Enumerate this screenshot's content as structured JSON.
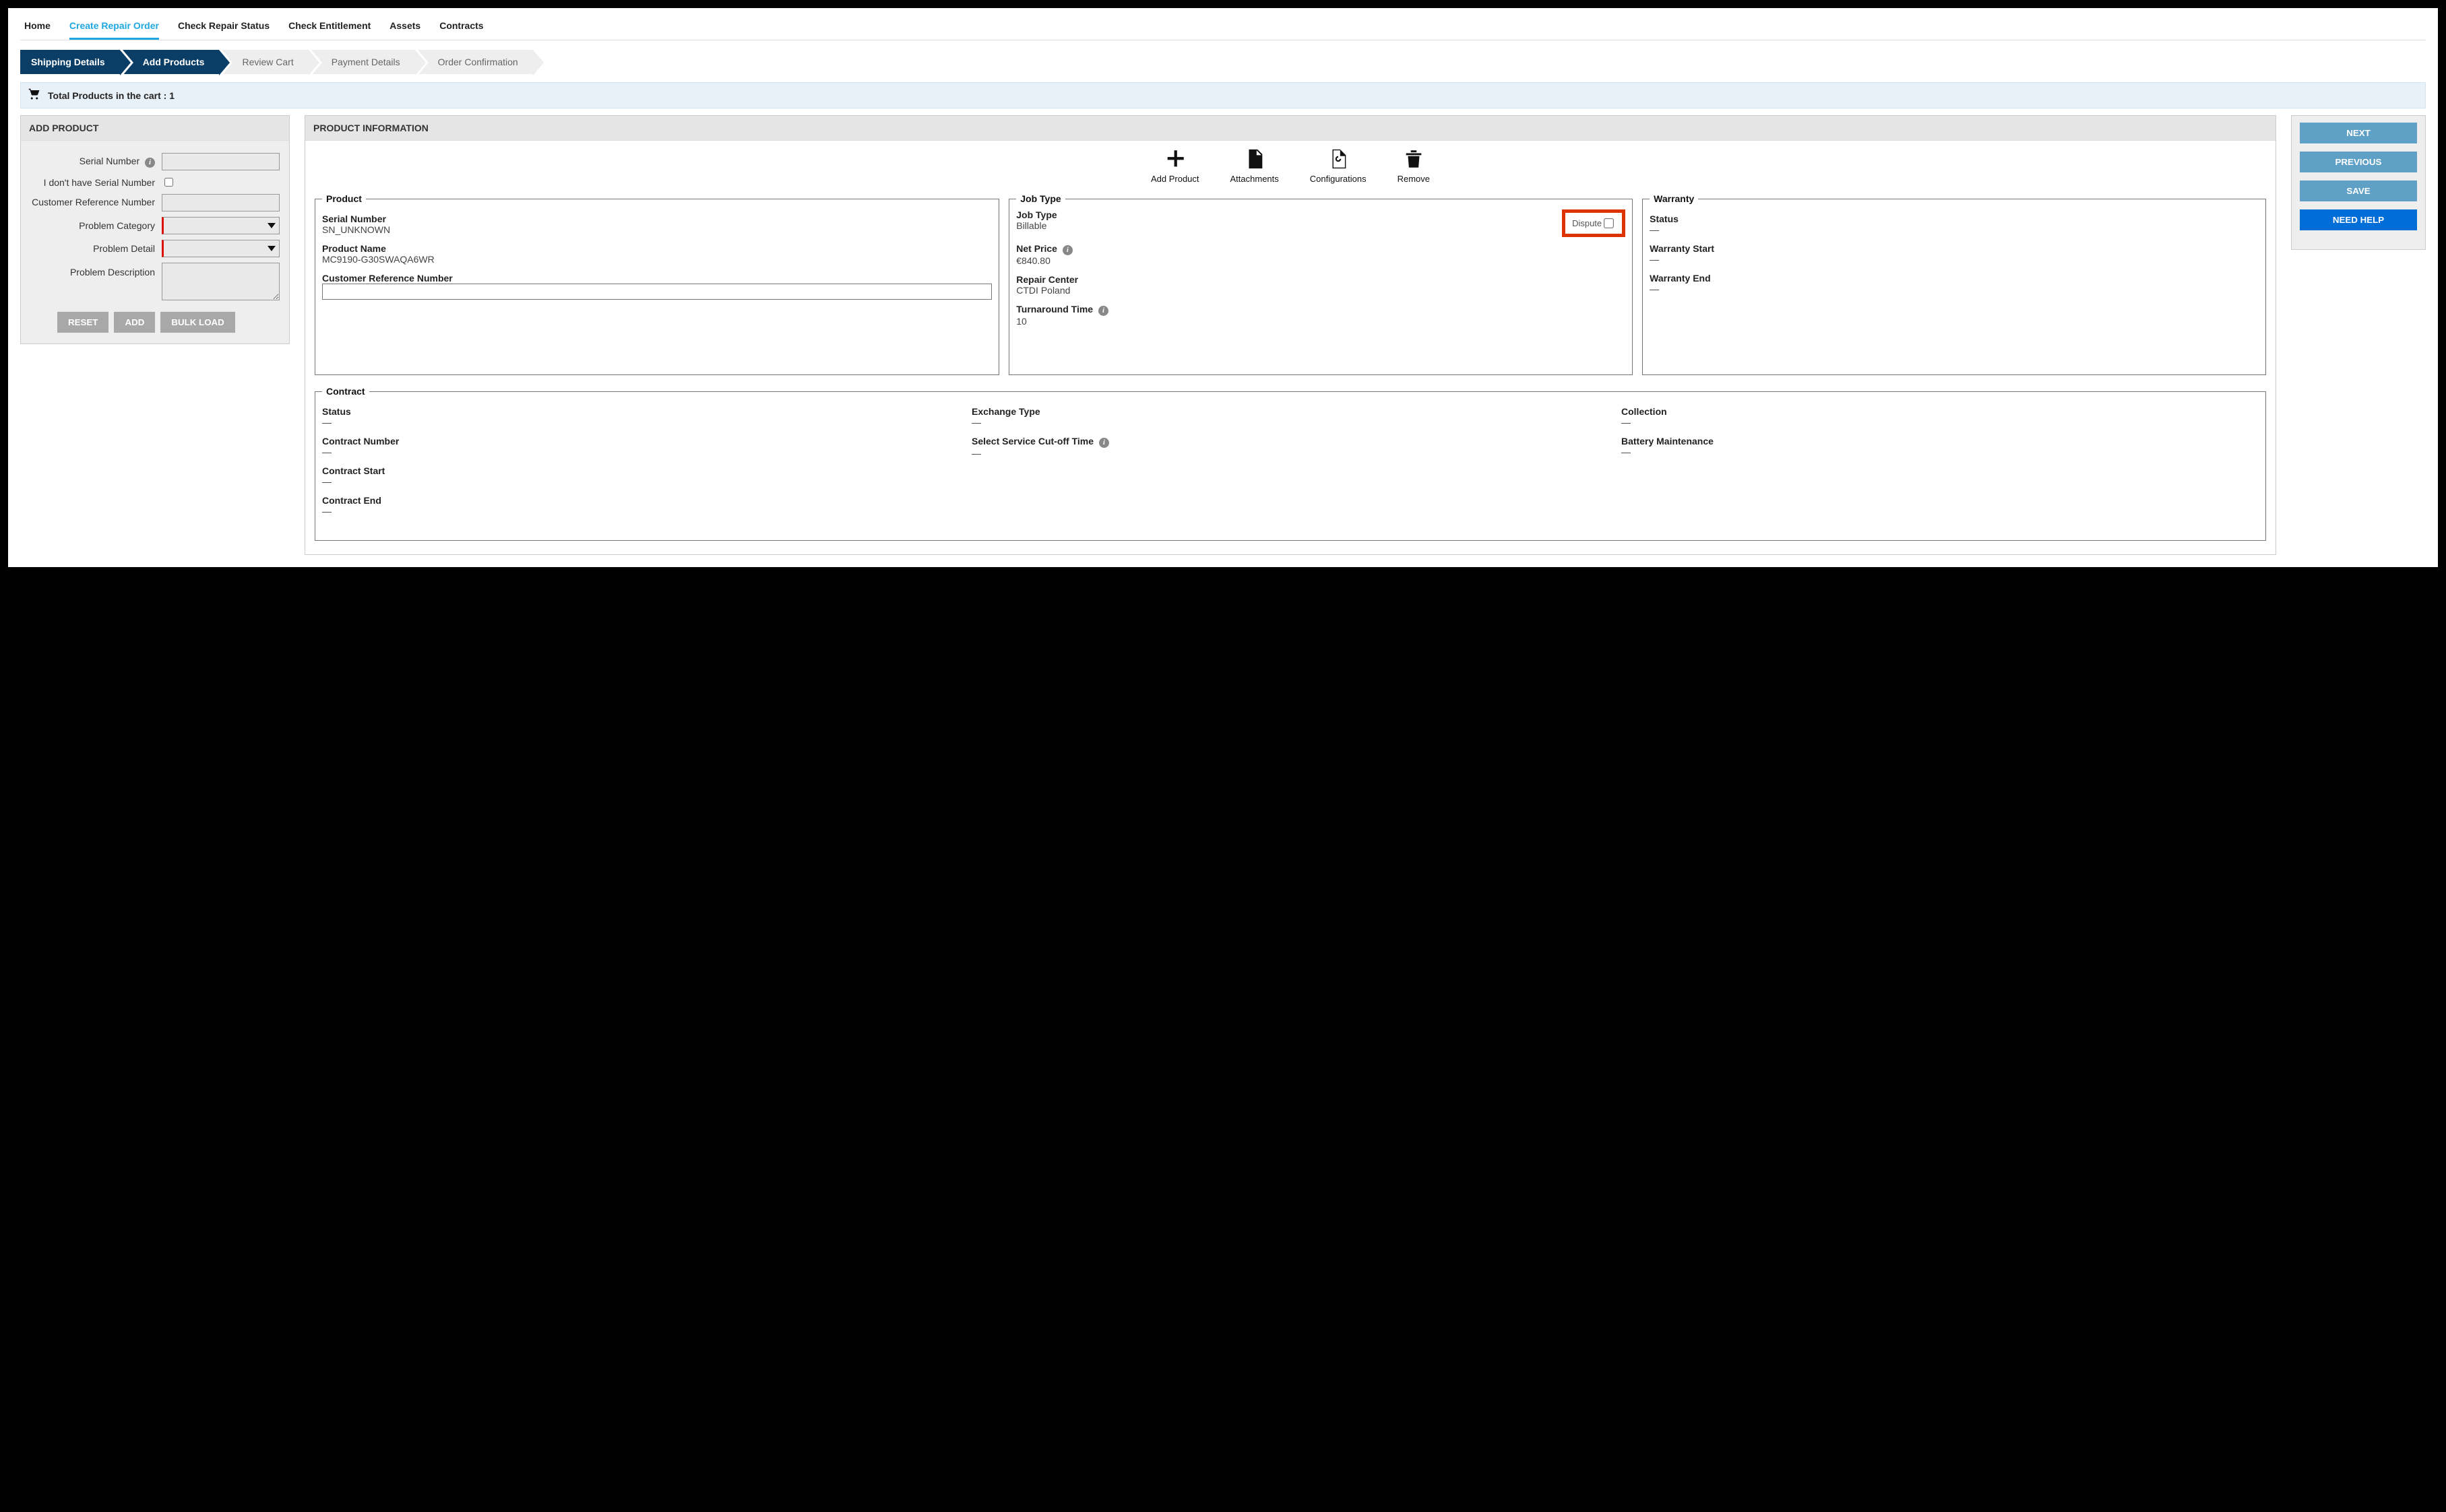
{
  "nav": {
    "items": [
      "Home",
      "Create Repair Order",
      "Check Repair Status",
      "Check Entitlement",
      "Assets",
      "Contracts"
    ],
    "active_index": 1
  },
  "wizard": {
    "steps": [
      "Shipping Details",
      "Add Products",
      "Review Cart",
      "Payment Details",
      "Order Confirmation"
    ],
    "done_through_index": 1
  },
  "cart": {
    "label": "Total Products in the cart : 1"
  },
  "add_product_panel": {
    "title": "ADD PRODUCT",
    "fields": {
      "serial_number_label": "Serial Number",
      "serial_number_value": "",
      "no_serial_label": "I don't have Serial Number",
      "no_serial_checked": false,
      "crn_label": "Customer Reference Number",
      "crn_value": "",
      "problem_category_label": "Problem Category",
      "problem_category_value": "",
      "problem_detail_label": "Problem Detail",
      "problem_detail_value": "",
      "problem_description_label": "Problem Description",
      "problem_description_value": ""
    },
    "buttons": {
      "reset": "RESET",
      "add": "ADD",
      "bulk": "BULK LOAD"
    }
  },
  "product_info_panel": {
    "title": "PRODUCT INFORMATION",
    "actions": {
      "add_product": "Add Product",
      "attachments": "Attachments",
      "configurations": "Configurations",
      "remove": "Remove"
    },
    "product": {
      "legend": "Product",
      "serial_number_label": "Serial Number",
      "serial_number_value": "SN_UNKNOWN",
      "product_name_label": "Product Name",
      "product_name_value": "MC9190-G30SWAQA6WR",
      "crn_label": "Customer Reference Number",
      "crn_value": ""
    },
    "jobtype": {
      "legend": "Job Type",
      "job_type_label": "Job Type",
      "job_type_value": "Billable",
      "dispute_label": "Dispute",
      "dispute_checked": false,
      "net_price_label": "Net Price",
      "net_price_value": "€840.80",
      "repair_center_label": "Repair Center",
      "repair_center_value": "CTDI Poland",
      "turnaround_label": "Turnaround Time",
      "turnaround_value": "10"
    },
    "warranty": {
      "legend": "Warranty",
      "status_label": "Status",
      "status_value": "—",
      "start_label": "Warranty Start",
      "start_value": "—",
      "end_label": "Warranty End",
      "end_value": "—"
    },
    "contract": {
      "legend": "Contract",
      "status_label": "Status",
      "status_value": "—",
      "contract_number_label": "Contract Number",
      "contract_number_value": "—",
      "contract_start_label": "Contract Start",
      "contract_start_value": "—",
      "contract_end_label": "Contract End",
      "contract_end_value": "—",
      "exchange_type_label": "Exchange Type",
      "exchange_type_value": "—",
      "cutoff_label": "Select Service Cut-off Time",
      "cutoff_value": "—",
      "collection_label": "Collection",
      "collection_value": "—",
      "battery_label": "Battery Maintenance",
      "battery_value": "—"
    }
  },
  "right_buttons": {
    "next": "NEXT",
    "previous": "PREVIOUS",
    "save": "SAVE",
    "help": "NEED HELP"
  }
}
